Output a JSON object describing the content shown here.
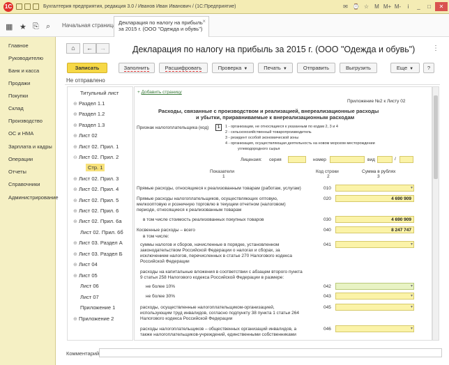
{
  "titlebar": {
    "title": "Бухгалтерия предприятия, редакция 3.0 / Иванов Иван Иванович / (1С:Предприятие)",
    "logo": "1С"
  },
  "toolbar": {
    "home_tab": "Начальная страница",
    "active_tab_line1": "Декларация по налогу на прибыль",
    "active_tab_line2": "за 2015 г. (ООО \"Одежда и обувь\")"
  },
  "sidebar": {
    "items": [
      "Главное",
      "Руководителю",
      "Банк и касса",
      "Продажи",
      "Покупки",
      "Склад",
      "Производство",
      "ОС и НМА",
      "Зарплата и кадры",
      "Операции",
      "Отчеты",
      "Справочники",
      "Администрирование"
    ]
  },
  "form": {
    "title": "Декларация по налогу на прибыль за 2015 г. (ООО \"Одежда и обувь\")",
    "more": "⋮",
    "buttons": {
      "save": "Записать",
      "fill": "Заполнить",
      "decode": "Расшифровать",
      "check": "Проверка",
      "print": "Печать",
      "send": "Отправить",
      "upload": "Выгрузить",
      "more": "Еще",
      "help": "?"
    },
    "status": "Не отправлено"
  },
  "tree": {
    "items": [
      {
        "label": "Титульный лист",
        "exp": ""
      },
      {
        "label": "Раздел 1.1",
        "exp": "⊕"
      },
      {
        "label": "Раздел 1.2",
        "exp": "⊕"
      },
      {
        "label": "Раздел 1.3",
        "exp": "⊕"
      },
      {
        "label": "Лист 02",
        "exp": "⊕"
      },
      {
        "label": "Лист 02. Прил. 1",
        "exp": "⊕"
      },
      {
        "label": "Лист 02. Прил. 2",
        "exp": "⊖"
      },
      {
        "label": "Стр. 1",
        "exp": ""
      },
      {
        "label": "Лист 02. Прил. 3",
        "exp": "⊕"
      },
      {
        "label": "Лист 02. Прил. 4",
        "exp": "⊕"
      },
      {
        "label": "Лист 02. Прил. 5",
        "exp": "⊕"
      },
      {
        "label": "Лист 02. Прил. 6",
        "exp": "⊕"
      },
      {
        "label": "Лист 02. Прил. 6а",
        "exp": "⊕"
      },
      {
        "label": "Лист 02. Прил. 6б",
        "exp": ""
      },
      {
        "label": "Лист 03. Раздел А",
        "exp": "⊕"
      },
      {
        "label": "Лист 03. Раздел Б",
        "exp": "⊕"
      },
      {
        "label": "Лист 04",
        "exp": "⊕"
      },
      {
        "label": "Лист 05",
        "exp": "⊕"
      },
      {
        "label": "Лист 06",
        "exp": ""
      },
      {
        "label": "Лист 07",
        "exp": ""
      },
      {
        "label": "Приложение 1",
        "exp": ""
      },
      {
        "label": "Приложение 2",
        "exp": "⊕"
      }
    ]
  },
  "doc": {
    "add_page": "Добавить страницу",
    "appendix": "Приложение №2 к Листу 02",
    "heading1": "Расходы, связанные с производством и реализацией, внереализационные расходы",
    "heading2": "и убытки, приравниваемые к внереализационным расходам",
    "taxpayer_label": "Признак налогоплательщика (код)",
    "taxpayer_code": "1",
    "taxpayer_opts": [
      "1 - организации, не относящиеся к указанным по кодам 2, 3 и 4",
      "2 - сельскохозяйственный товаропроизводитель",
      "3 - резидент особой экономической зоны",
      "4 - организация, осуществляющая деятельность на новом морском месторождении",
      "углеводородного сырья"
    ],
    "license": "Лицензия:",
    "series": "серия",
    "number": "номер",
    "kind": "вид",
    "col1": "Показатели",
    "col1n": "1",
    "col2": "Код строки",
    "col2n": "2",
    "col3": "Сумма в рублях",
    "col3n": "3",
    "rows": {
      "r010": "Прямые расходы, относящиеся к реализованным товарам (работам, услугам)",
      "r020a": "Прямые расходы налогоплательщиков, осуществляющих оптовую,",
      "r020b": "мелкооптовую и розничную торговлю в текущем отчетном (налоговом)",
      "r020c": "периоде, относящиеся к реализованным товарам",
      "r030": "в том числе стоимость реализованных покупных товаров",
      "r040a": "Косвенные расходы – всего",
      "r040b": "в том числе:",
      "r041a": "суммы налогов и сборов, начисленные в порядке, установленном",
      "r041b": "законодательством Российской Федерации о налогах и сборах, за",
      "r041c": "исключением налогов, перечисленных в статье 270 Налогового кодекса",
      "r041d": "Российской Федерации",
      "r042a": "расходы на капитальные вложения в соответствии с абзацем второго пункта",
      "r042b": "9 статьи 258 Налогового кодекса Российской Федерации в размере:",
      "r042c": "не более 10%",
      "r043": "не более 30%",
      "r045a": "расходы, осуществленные налогоплательщиком-организацией,",
      "r045b": "использующим труд инвалидов, согласно подпункту 38 пункта 1 статьи 264",
      "r045c": "Налогового кодекса Российской Федерации",
      "r046a": "расходы налогоплательщиков – общественных организаций инвалидов, а",
      "r046b": "также налогоплательщиков-учреждений, единственными собственниками"
    },
    "codes": [
      "010",
      "020",
      "030",
      "040",
      "041",
      "042",
      "043",
      "045",
      "046"
    ],
    "values": {
      "v020": "4 690 909",
      "v030": "4 690 909",
      "v040": "8 247 747"
    }
  },
  "comment_label": "Комментарий:"
}
